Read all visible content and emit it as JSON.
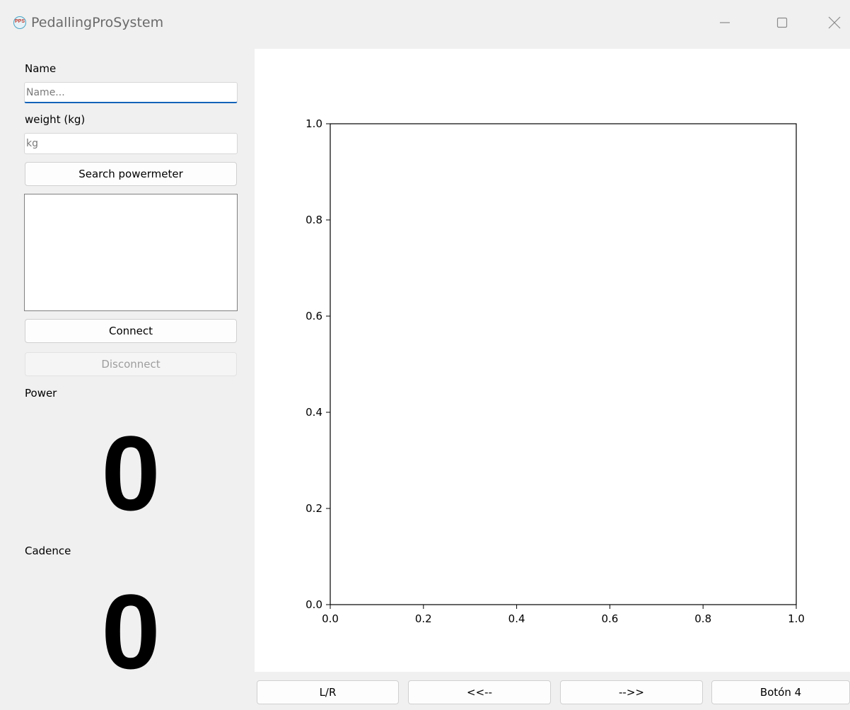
{
  "window": {
    "title": "PedallingProSystem",
    "app_icon_text": "PPS",
    "controls": [
      "minimize-icon",
      "maximize-icon",
      "close-icon"
    ]
  },
  "left_panel": {
    "name_label": "Name",
    "name_placeholder": "Name...",
    "weight_label": "weight (kg)",
    "weight_placeholder": "kg",
    "search_button": "Search powermeter",
    "device_list": [],
    "connect_button": "Connect",
    "disconnect_button": "Disconnect",
    "power_label": "Power",
    "power_value": "0",
    "cadence_label": "Cadence",
    "cadence_value": "0"
  },
  "chart_data": {
    "type": "line",
    "series": [],
    "xlim": [
      0.0,
      1.0
    ],
    "ylim": [
      0.0,
      1.0
    ],
    "x_ticks": [
      "0.0",
      "0.2",
      "0.4",
      "0.6",
      "0.8",
      "1.0"
    ],
    "y_ticks": [
      "0.0",
      "0.2",
      "0.4",
      "0.6",
      "0.8",
      "1.0"
    ],
    "title": "",
    "xlabel": "",
    "ylabel": "",
    "grid": false
  },
  "bottom_bar": {
    "buttons": [
      "L/R",
      "<<--",
      "-->>",
      "Botón 4"
    ]
  }
}
